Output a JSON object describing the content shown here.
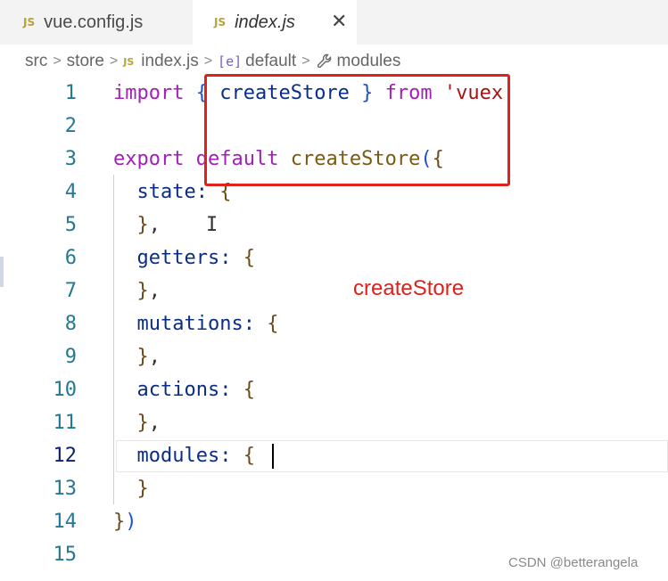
{
  "tabs": [
    {
      "badge": "JS",
      "label": "vue.config.js"
    },
    {
      "badge": "JS",
      "label": "index.js",
      "close": "✕"
    }
  ],
  "breadcrumb": {
    "items": [
      "src",
      "store",
      "index.js",
      "default",
      "modules"
    ],
    "separator": ">",
    "file_badge": "JS",
    "symbol_icon": "[e]"
  },
  "editor": {
    "line_numbers": [
      "1",
      "2",
      "3",
      "4",
      "5",
      "6",
      "7",
      "8",
      "9",
      "10",
      "11",
      "12",
      "13",
      "14",
      "15"
    ],
    "active_line": "12",
    "lines": {
      "l1": {
        "import": "import",
        "open": "{",
        "name": " createStore ",
        "close": "}",
        "from": " from ",
        "source": "'vuex'"
      },
      "l3": {
        "export": "export",
        "default": " default ",
        "fn": "createStore",
        "paren": "(",
        "brace": "{"
      },
      "l4": {
        "key": "  state: ",
        "brace": "{"
      },
      "l5": {
        "close": "  }",
        "comma": ","
      },
      "l6": {
        "key": "  getters: ",
        "brace": "{"
      },
      "l7": {
        "close": "  }",
        "comma": ","
      },
      "l8": {
        "key": "  mutations: ",
        "brace": "{"
      },
      "l9": {
        "close": "  }",
        "comma": ","
      },
      "l10": {
        "key": "  actions: ",
        "brace": "{"
      },
      "l11": {
        "close": "  }",
        "comma": ","
      },
      "l12": {
        "key": "  modules: ",
        "brace": "{"
      },
      "l13": {
        "close": "  }"
      },
      "l14": {
        "brace": "}",
        "paren": ")"
      }
    }
  },
  "annotation": {
    "label": "createStore",
    "color": "#e0201a"
  },
  "watermark": "CSDN @betterangela"
}
